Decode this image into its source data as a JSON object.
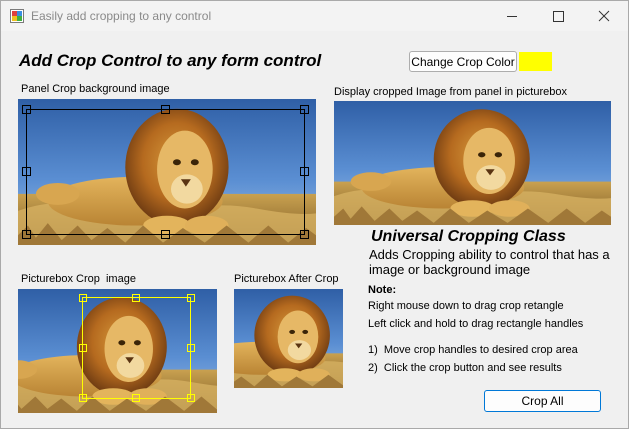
{
  "window": {
    "title": "Easily add cropping to any control"
  },
  "heading": "Add Crop Control to any form control",
  "change_crop_color_button": "Change Crop Color",
  "crop_color": "#ffff00",
  "panel_label": "Panel Crop background image",
  "display_label": "Display cropped Image from panel in picturebox",
  "picturebox_label": "Picturebox Crop  image",
  "after_label": "Picturebox After Crop",
  "class_title": "Universal Cropping Class",
  "class_description": "Adds Cropping ability to control that has a image or background image",
  "note_title": "Note:",
  "note_lines": [
    "Right mouse down to drag crop retangle",
    "Left click and hold to drag rectangle handles"
  ],
  "steps": [
    "1)  Move crop handles to desired crop area",
    "2)  Click the crop button and see results"
  ],
  "crop_all_button": "Crop All",
  "colors": {
    "panel_crop": "#000000",
    "picturebox_crop": "#ffff00",
    "button_accent": "#0078d7"
  },
  "icons": [
    "app-icon",
    "minimize-icon",
    "maximize-icon",
    "close-icon"
  ]
}
